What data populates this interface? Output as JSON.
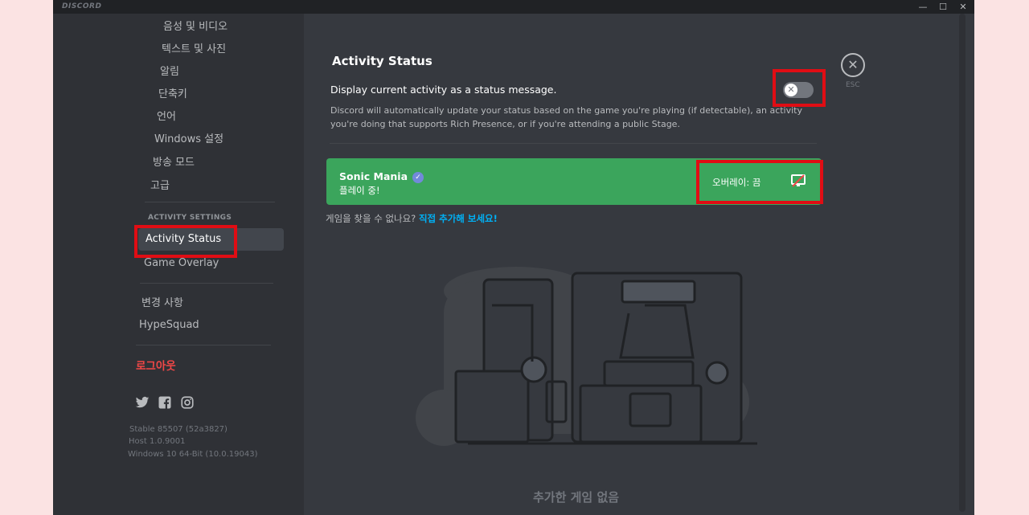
{
  "window": {
    "brand": "DISCORD",
    "controls": [
      "—",
      "☐",
      "✕"
    ]
  },
  "sidebar": {
    "items_top": [
      "음성 및 비디오",
      "텍스트 및 사진",
      "알림",
      "단축키",
      "언어",
      "Windows 설정",
      "방송 모드",
      "고급"
    ],
    "section_header": "ACTIVITY SETTINGS",
    "activity_items": [
      "Activity Status",
      "Game Overlay"
    ],
    "items_bottom": [
      "변경 사항",
      "HypeSquad"
    ],
    "logout": "로그아웃",
    "social": [
      "twitter-icon",
      "facebook-icon",
      "instagram-icon"
    ],
    "version_lines": [
      "Stable 85507 (52a3827)",
      "Host 1.0.9001",
      "Windows 10 64-Bit (10.0.19043)"
    ]
  },
  "main": {
    "title": "Activity Status",
    "toggle_label": "Display current activity as a status message.",
    "toggle_on": false,
    "description": "Discord will automatically update your status based on the game you're playing (if detectable), an activity you're doing that supports Rich Presence, or if you're attending a public Stage.",
    "esc_label": "ESC",
    "game": {
      "name": "Sonic Mania",
      "status": "플레이 중!",
      "overlay_label": "오버레이: 끔"
    },
    "help_prefix": "게임을 찾을 수 없나요? ",
    "help_link": "직접 추가해 보세요!",
    "empty_label": "추가한 게임 없음"
  },
  "colors": {
    "accent_green": "#3ba55c",
    "link": "#00b0f4",
    "danger": "#f04747",
    "highlight": "#e00d14"
  }
}
